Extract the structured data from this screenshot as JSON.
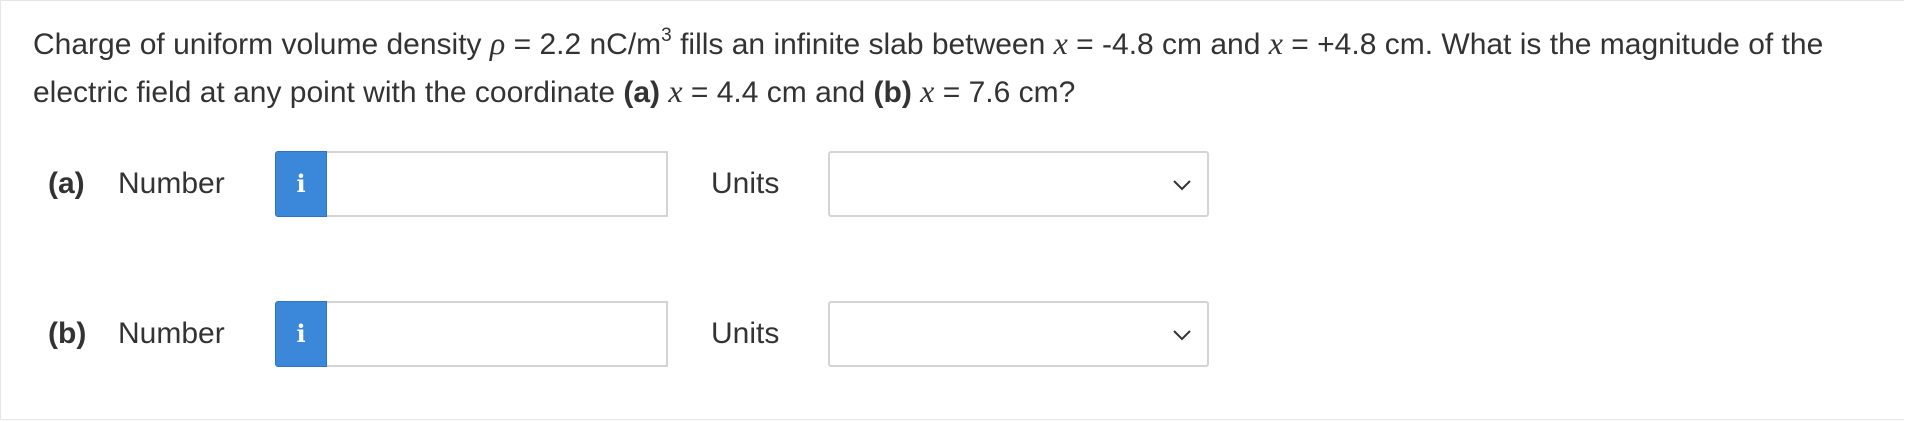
{
  "question": {
    "p1": "Charge of uniform volume density ",
    "rho": "ρ",
    "p2": " = 2.2 nC/m",
    "exp": "3",
    "p3": " fills an infinite slab between ",
    "x1": "x",
    "p4": " = -4.8 cm and ",
    "x2": "x",
    "p5": " = +4.8 cm. What is the magnitude of the electric field at any point with the coordinate ",
    "a_label": "(a)",
    "x3": "x",
    "p6": " = 4.4 cm and ",
    "b_label": "(b)",
    "x4": "x",
    "p7": " = 7.6 cm?"
  },
  "parts": [
    {
      "label": "(a)",
      "number_label": "Number",
      "info_glyph": "i",
      "number_value": "",
      "units_label": "Units",
      "units_value": ""
    },
    {
      "label": "(b)",
      "number_label": "Number",
      "info_glyph": "i",
      "number_value": "",
      "units_label": "Units",
      "units_value": ""
    }
  ],
  "colors": {
    "info_button": "#3b87d9",
    "text": "#333333",
    "border": "#d4d4d4"
  },
  "icons": {
    "info": "info-icon",
    "dropdown": "chevron-down-icon"
  }
}
